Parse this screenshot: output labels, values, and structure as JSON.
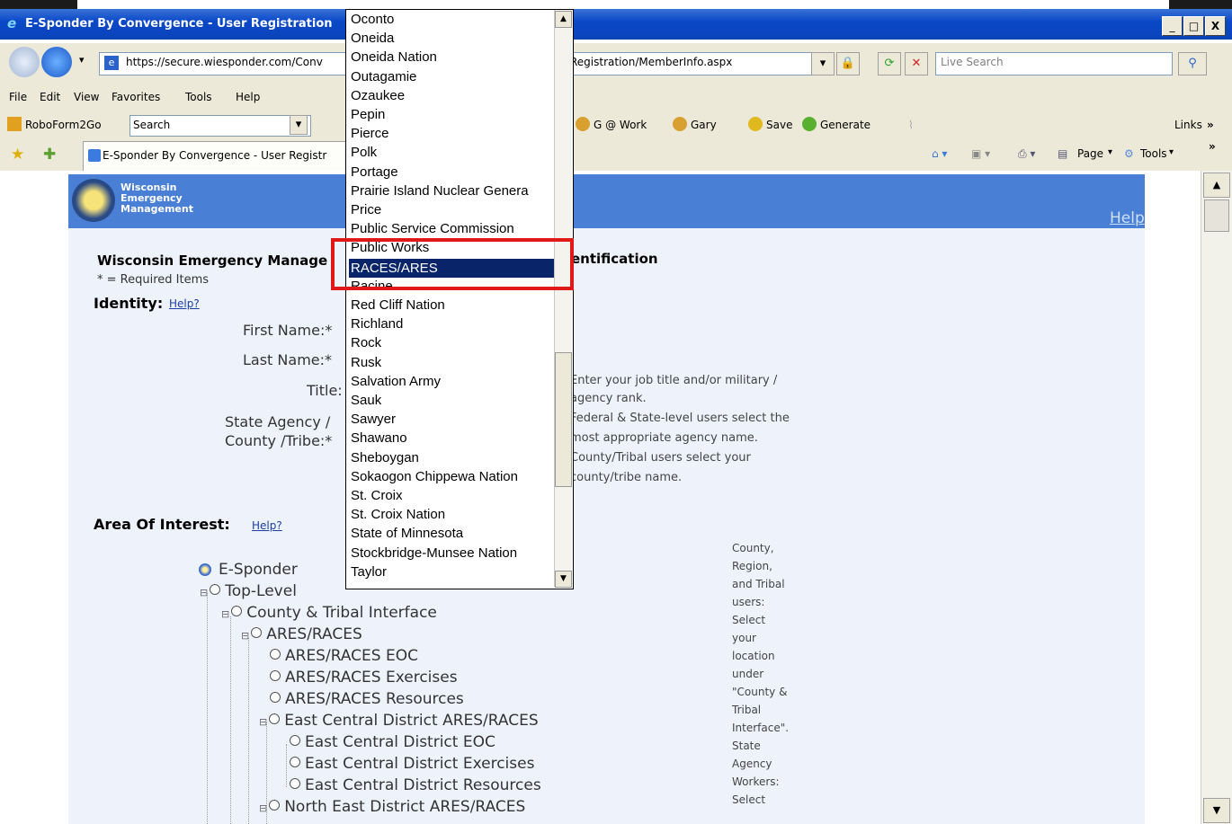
{
  "window": {
    "title": "E-Sponder By Convergence - User Registration",
    "minimize": "_",
    "maximize": "□",
    "close": "X"
  },
  "nav": {
    "address": "https://secure.wiesponder.com/Conv",
    "address_end": "Registration/MemberInfo.aspx",
    "search_placeholder": "Live Search"
  },
  "menu": [
    "File",
    "Edit",
    "View",
    "Favorites",
    "Tools",
    "Help"
  ],
  "toolbar2": {
    "roboform": "RoboForm2Go",
    "search_box": "Search",
    "items": [
      "G @ Work",
      "Gary",
      "Save",
      "Generate"
    ],
    "links": "Links"
  },
  "tabbar": {
    "tab_title": "E-Sponder By Convergence - User Registr",
    "page": "Page",
    "tools": "Tools"
  },
  "banner": {
    "line1": "Wisconsin",
    "line2": "Emergency",
    "line3": "Management",
    "help": "Help"
  },
  "form": {
    "heading_start": "Wisconsin Emergency Manage",
    "heading_end": "entification",
    "required_note": "* = Required Items",
    "identity": "Identity:",
    "help_q": "Help?",
    "first_name": "First Name:*",
    "last_name": "Last Name:*",
    "title": "Title:",
    "state_agency": "State Agency /",
    "county_tribe": "County /Tribe:*",
    "hints": [
      "Enter your job title and/or military /",
      "agency rank.",
      "Federal & State-level users select the",
      "most appropriate agency name.",
      "County/Tribal users select your",
      "county/tribe name."
    ],
    "area_of_interest": "Area Of Interest:",
    "side_note": [
      "County,",
      "Region,",
      "and Tribal",
      "users:",
      "Select",
      "your",
      "location",
      "under",
      "\"County &",
      "Tribal",
      "Interface\".",
      "State",
      "Agency",
      "Workers:",
      "Select"
    ]
  },
  "tree": [
    {
      "label": "E-Sponder"
    },
    {
      "label": "Top-Level"
    },
    {
      "label": "County & Tribal Interface"
    },
    {
      "label": "ARES/RACES"
    },
    {
      "label": "ARES/RACES EOC"
    },
    {
      "label": "ARES/RACES Exercises"
    },
    {
      "label": "ARES/RACES Resources"
    },
    {
      "label": "East Central District ARES/RACES"
    },
    {
      "label": "East Central District EOC"
    },
    {
      "label": "East Central District Exercises"
    },
    {
      "label": "East Central District Resources"
    },
    {
      "label": "North East District ARES/RACES"
    }
  ],
  "dropdown": {
    "selected": "RACES/ARES",
    "options": [
      "Oconto",
      "Oneida",
      "Oneida Nation",
      "Outagamie",
      "Ozaukee",
      "Pepin",
      "Pierce",
      "Polk",
      "Portage",
      "Prairie Island Nuclear Genera",
      "Price",
      "Public Service Commission",
      "Public Works",
      "RACES/ARES",
      "Racine",
      "Red Cliff Nation",
      "Richland",
      "Rock",
      "Rusk",
      "Salvation Army",
      "Sauk",
      "Sawyer",
      "Shawano",
      "Sheboygan",
      "Sokaogon Chippewa Nation",
      "St. Croix",
      "St. Croix Nation",
      "State of Minnesota",
      "Stockbridge-Munsee Nation",
      "Taylor"
    ]
  },
  "colors": {
    "titlebar": "#0a48c8",
    "banner": "#4a7fd6",
    "selection": "#0a246a",
    "highlight": "#e01818"
  }
}
